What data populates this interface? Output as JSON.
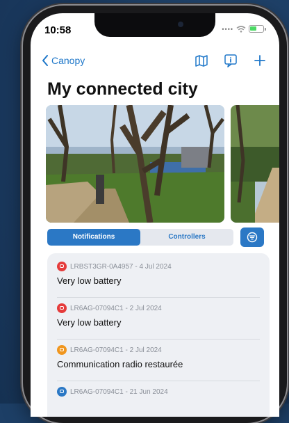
{
  "status": {
    "time": "10:58"
  },
  "nav": {
    "back_label": "Canopy"
  },
  "page": {
    "title": "My connected city"
  },
  "tabs": [
    {
      "label": "Notifications",
      "active": true
    },
    {
      "label": "Controllers",
      "active": false
    }
  ],
  "notifications": [
    {
      "device": "LRBST3GR-0A4957 - 4 Jul 2024",
      "message": "Very low battery",
      "color": "#e53b3b"
    },
    {
      "device": "LR6AG-07094C1 - 2 Jul 2024",
      "message": "Very low battery",
      "color": "#e53b3b"
    },
    {
      "device": "LR6AG-07094C1 - 2 Jul 2024",
      "message": "Communication radio restaurée",
      "color": "#f0961e"
    },
    {
      "device": "LR6AG-07094C1 - 21 Jun 2024",
      "message": "",
      "color": "#2b78c5"
    }
  ],
  "colors": {
    "accent": "#2b78c5",
    "background": "#1d3f66"
  },
  "icons": [
    "chevron-left-icon",
    "map-icon",
    "info-bubble-icon",
    "plus-icon",
    "filter-icon"
  ]
}
